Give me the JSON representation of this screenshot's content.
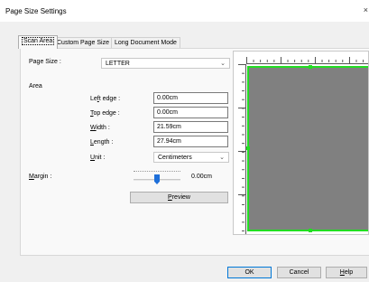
{
  "window": {
    "title": "Page Size Settings",
    "close_glyph": "×"
  },
  "tabs": [
    {
      "label": "Scan Area",
      "active": true
    },
    {
      "label": "Custom Page Size",
      "active": false
    },
    {
      "label": "Long Document Mode",
      "active": false
    }
  ],
  "page_size": {
    "label": "Page Size :",
    "value": "LETTER"
  },
  "area": {
    "heading": "Area",
    "left_edge": {
      "label_accel": "f",
      "label_pre": "Le",
      "label_post": "t edge :",
      "value": "0.00cm"
    },
    "top_edge": {
      "label_accel": "T",
      "label_pre": "",
      "label_post": "op edge :",
      "value": "0.00cm"
    },
    "width": {
      "label_accel": "W",
      "label_pre": "",
      "label_post": "idth :",
      "value": "21.59cm"
    },
    "length": {
      "label_accel": "L",
      "label_pre": "",
      "label_post": "ength :",
      "value": "27.94cm"
    },
    "unit": {
      "label_accel": "U",
      "label_pre": "",
      "label_post": "nit :",
      "value": "Centimeters"
    }
  },
  "margin": {
    "label_accel": "M",
    "label_post": "argin :",
    "value": "0.00cm"
  },
  "buttons": {
    "preview": {
      "accel": "P",
      "rest": "review"
    },
    "ok": "OK",
    "cancel": "Cancel",
    "help": {
      "accel": "H",
      "rest": "elp"
    }
  },
  "icons": {
    "dropdown": "chevron-down-icon"
  }
}
